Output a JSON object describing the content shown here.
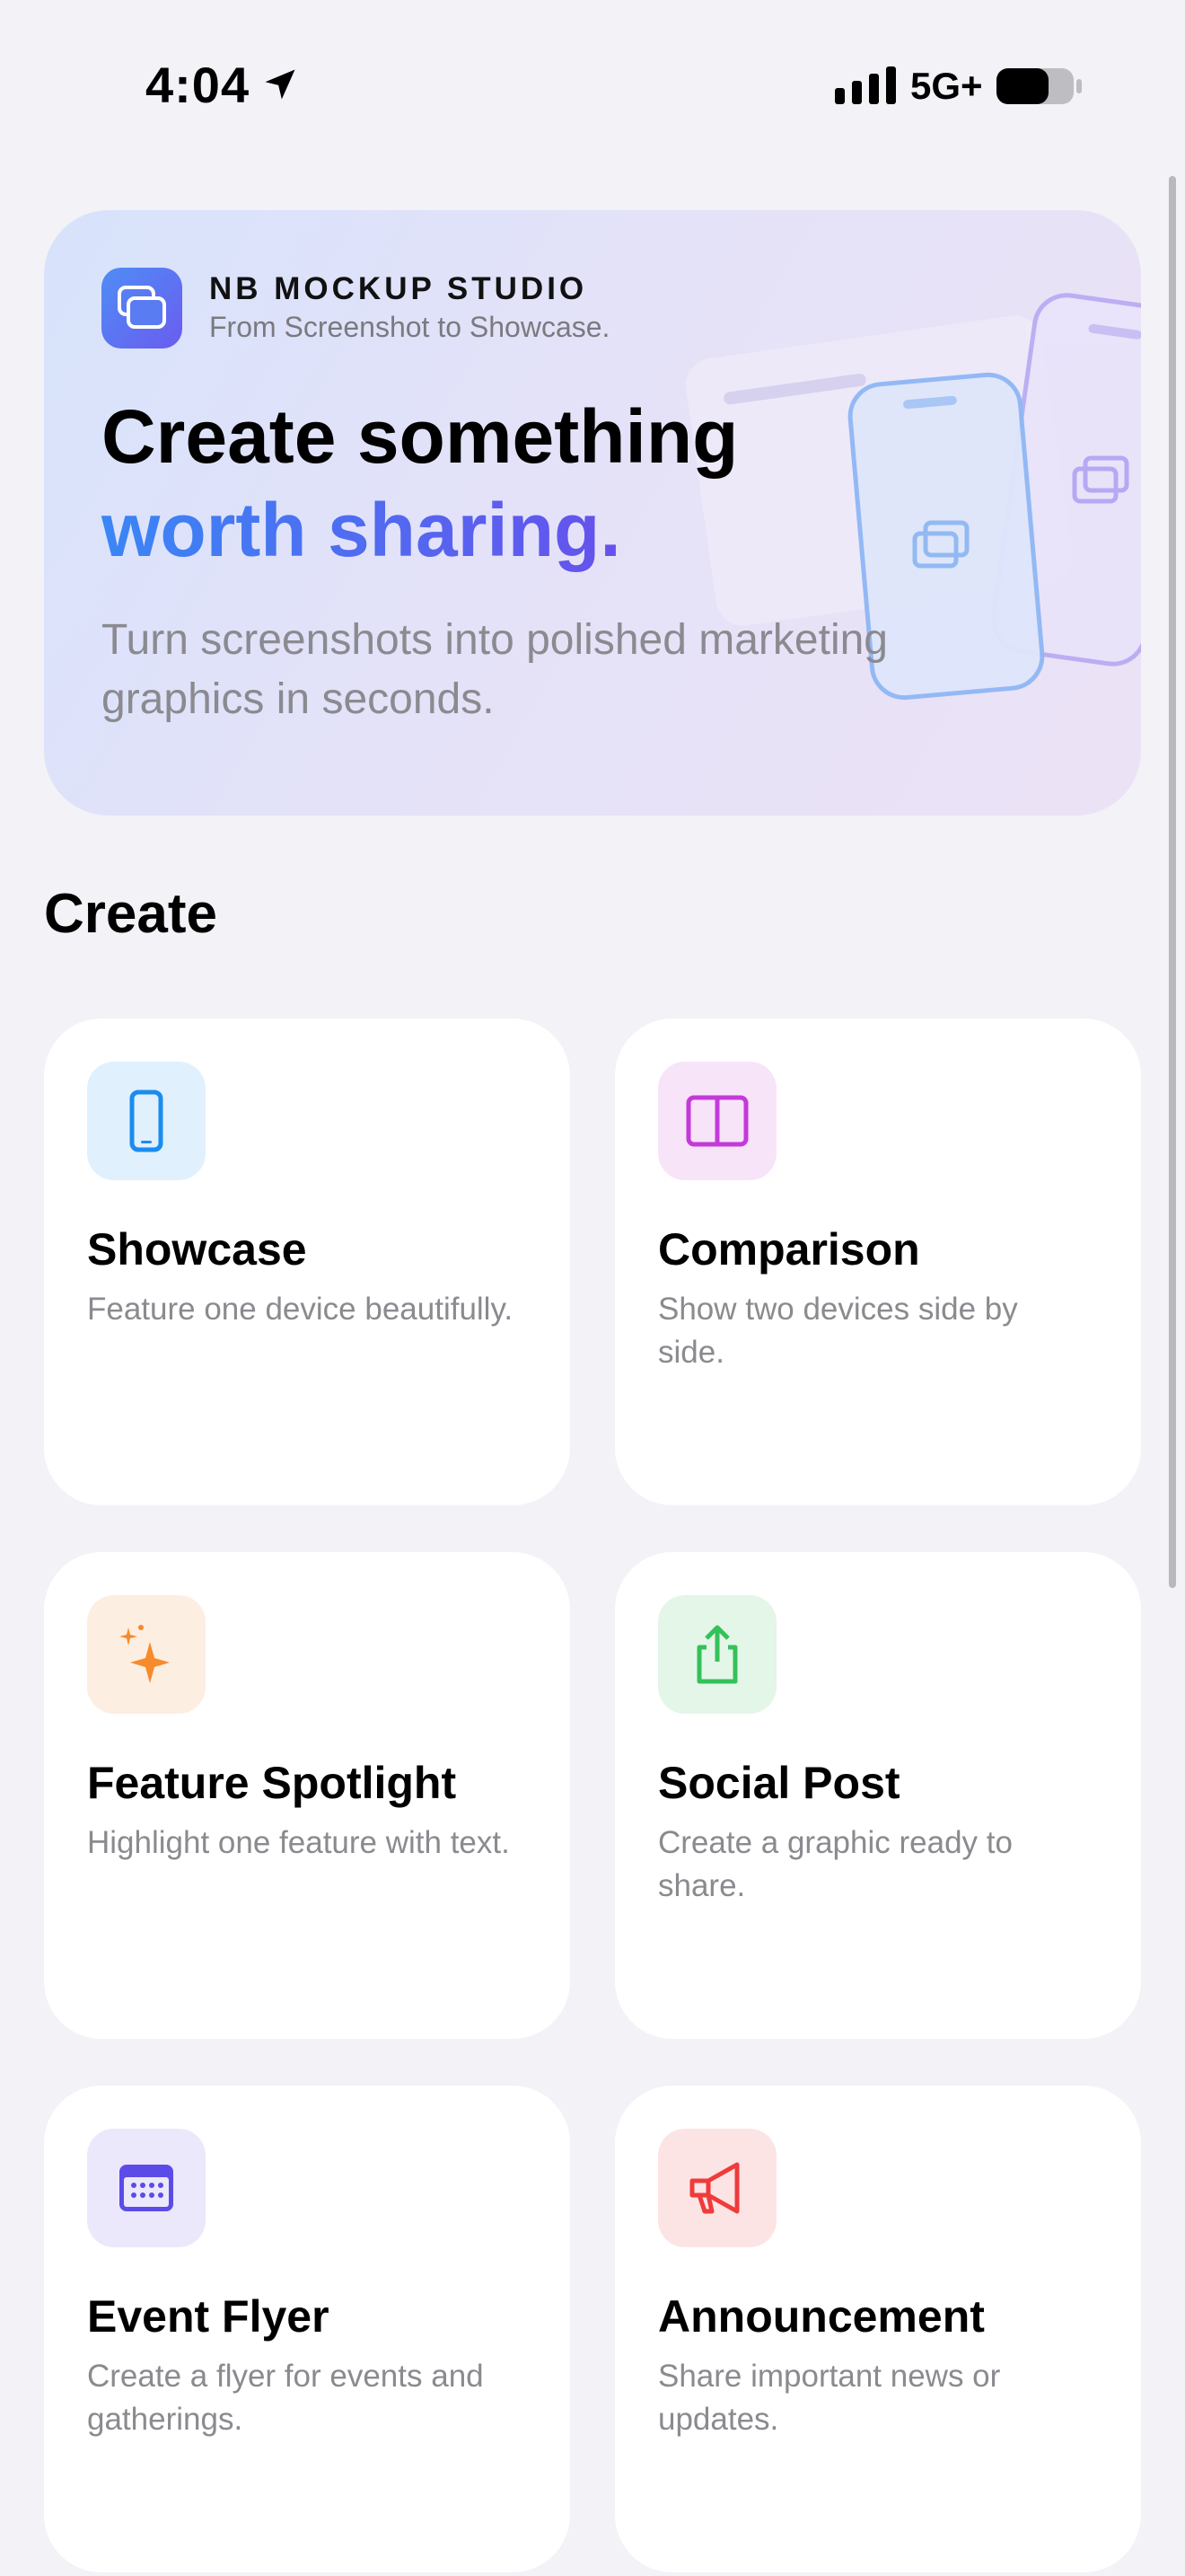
{
  "status_bar": {
    "time": "4:04",
    "network": "5G+"
  },
  "hero": {
    "brand_name": "NB MOCKUP STUDIO",
    "brand_tagline": "From Screenshot to Showcase.",
    "title_line1": "Create something",
    "title_line2": "worth sharing.",
    "subtitle": "Turn screenshots into polished marketing graphics in seconds."
  },
  "section": {
    "title": "Create"
  },
  "cards": [
    {
      "title": "Showcase",
      "desc": "Feature one device beautifully.",
      "icon": "phone-icon",
      "color": "#1a8cf0",
      "bg": "#e1f0fd"
    },
    {
      "title": "Comparison",
      "desc": "Show two devices side by side.",
      "icon": "split-view-icon",
      "color": "#c43ad9",
      "bg": "#f7e4f9"
    },
    {
      "title": "Feature Spotlight",
      "desc": "Highlight one feature with text.",
      "icon": "sparkles-icon",
      "color": "#f78a2a",
      "bg": "#fdeee2"
    },
    {
      "title": "Social Post",
      "desc": "Create a graphic ready to share.",
      "icon": "share-icon",
      "color": "#34c159",
      "bg": "#e3f6e8"
    },
    {
      "title": "Event Flyer",
      "desc": "Create a flyer for events and gatherings.",
      "icon": "calendar-icon",
      "color": "#5b4ce8",
      "bg": "#ebe8fc"
    },
    {
      "title": "Announcement",
      "desc": "Share important news or updates.",
      "icon": "megaphone-icon",
      "color": "#ef3b3b",
      "bg": "#fde4e4"
    }
  ]
}
